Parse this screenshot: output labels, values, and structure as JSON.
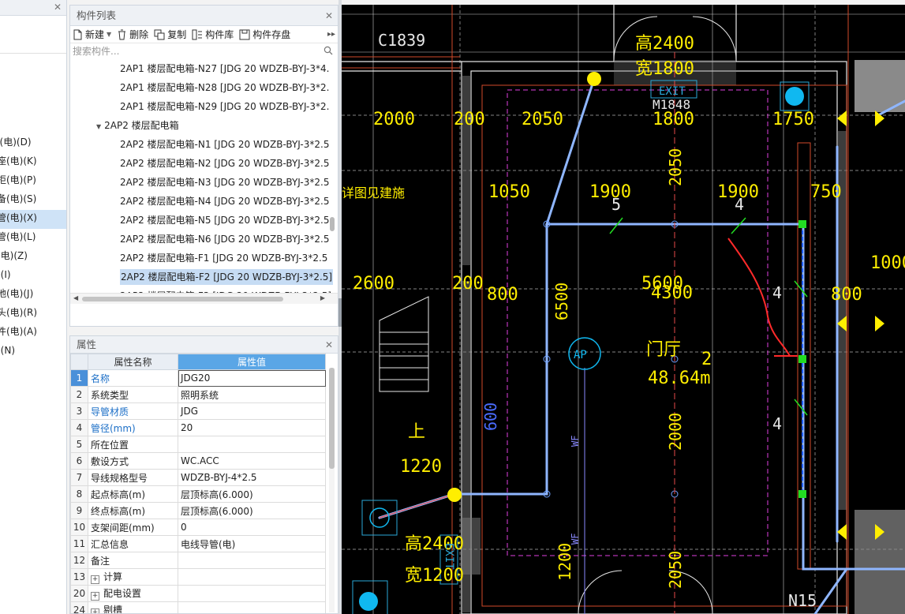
{
  "left_tree": {
    "items": [
      {
        "label": "J具(电)(D)"
      },
      {
        "label": "插座(电)(K)"
      },
      {
        "label": "箱柜(电)(P)"
      },
      {
        "label": "设备(电)(S)"
      },
      {
        "label": "导管(电)(X)",
        "selected": true
      },
      {
        "label": "等管(电)(L)"
      },
      {
        "label": "线(电)(Z)"
      },
      {
        "label": "电)(I)"
      },
      {
        "label": "接地(电)(J)"
      },
      {
        "label": "接头(电)(R)"
      },
      {
        "label": "构件(电)(A)"
      },
      {
        "label": "电)(N)"
      }
    ]
  },
  "component_panel": {
    "title": "构件列表",
    "toolbar": {
      "new": "新建",
      "delete": "删除",
      "copy": "复制",
      "library": "构件库",
      "save": "构件存盘"
    },
    "search_placeholder": "搜索构件...",
    "items": [
      {
        "label": "2AP1 楼层配电箱-N27 [JDG 20 WDZB-BYJ-3*4."
      },
      {
        "label": "2AP1 楼层配电箱-N28 [JDG 20 WDZB-BYJ-3*2."
      },
      {
        "label": "2AP1 楼层配电箱-N29 [JDG 20 WDZB-BYJ-3*2."
      },
      {
        "label": "2AP2 楼层配电箱",
        "group": true
      },
      {
        "label": "2AP2 楼层配电箱-N1 [JDG 20 WDZB-BYJ-3*2.5"
      },
      {
        "label": "2AP2 楼层配电箱-N2 [JDG 20 WDZB-BYJ-3*2.5"
      },
      {
        "label": "2AP2 楼层配电箱-N3 [JDG 20 WDZB-BYJ-3*2.5"
      },
      {
        "label": "2AP2 楼层配电箱-N4 [JDG 20 WDZB-BYJ-3*2.5"
      },
      {
        "label": "2AP2 楼层配电箱-N5 [JDG 20 WDZB-BYJ-3*2.5"
      },
      {
        "label": "2AP2 楼层配电箱-N6 [JDG 20 WDZB-BYJ-3*2.5"
      },
      {
        "label": "2AP2 楼层配电箱-F1 [JDG 20 WDZB-BYJ-3*2.5"
      },
      {
        "label": "2AP2 楼层配电箱-F2 [JDG 20 WDZB-BYJ-3*2.5]",
        "selected": true
      },
      {
        "label": "2AP2 楼层配电箱-F3 [JDG 20 WDZB-BYJ-3*2.5]"
      }
    ]
  },
  "properties_panel": {
    "title": "属性",
    "col_name": "属性名称",
    "col_value": "属性值",
    "rows": [
      {
        "idx": "1",
        "key": "名称",
        "value": "JDG20",
        "blue": true,
        "selected": true
      },
      {
        "idx": "2",
        "key": "系统类型",
        "value": "照明系统"
      },
      {
        "idx": "3",
        "key": "导管材质",
        "value": "JDG",
        "blue": true
      },
      {
        "idx": "4",
        "key": "管径(mm)",
        "value": "20",
        "blue": true
      },
      {
        "idx": "5",
        "key": "所在位置",
        "value": ""
      },
      {
        "idx": "6",
        "key": "敷设方式",
        "value": "WC.ACC"
      },
      {
        "idx": "7",
        "key": "导线规格型号",
        "value": "WDZB-BYJ-4*2.5"
      },
      {
        "idx": "8",
        "key": "起点标高(m)",
        "value": "层顶标高(6.000)"
      },
      {
        "idx": "9",
        "key": "终点标高(m)",
        "value": "层顶标高(6.000)"
      },
      {
        "idx": "10",
        "key": "支架间距(mm)",
        "value": "0"
      },
      {
        "idx": "11",
        "key": "汇总信息",
        "value": "电线导管(电)"
      },
      {
        "idx": "12",
        "key": "备注",
        "value": ""
      },
      {
        "idx": "13",
        "key": "计算",
        "value": "",
        "expand": true
      },
      {
        "idx": "20",
        "key": "配电设置",
        "value": "",
        "expand": true
      },
      {
        "idx": "24",
        "key": "剔槽",
        "value": "",
        "expand": true
      }
    ]
  },
  "cad_labels": {
    "room_c1839": "C1839",
    "h2400_top": "高2400",
    "w1800_top": "宽1800",
    "exit_top": "EXIT",
    "m1848": "M1848",
    "d2000": "2000",
    "d200a": "200",
    "d2050a": "2050",
    "d1800": "1800",
    "d1750": "1750",
    "detail_note": "详图见建施",
    "d1050": "1050",
    "d1900a": "1900",
    "d1900b": "1900",
    "d5": "5",
    "d4a": "4",
    "d750": "750",
    "d2050v": "2050",
    "d2600": "2600",
    "d200b": "200",
    "d800a": "800",
    "d5600": "5600",
    "d4300": "4300",
    "d1000": "1000",
    "d800b": "800",
    "d6500": "6500",
    "ap": "AP",
    "hall": "门厅",
    "area": "48.64m",
    "d2": "2",
    "d4b": "4",
    "d4c": "4",
    "d600": "600",
    "up": "上",
    "d1220": "1220",
    "d2000v": "2000",
    "wf1": "WF",
    "wf2": "WF",
    "h2400_bot": "高2400",
    "exit_bot": "EXIT",
    "w1200": "宽1200",
    "d1200v": "1200",
    "d2050v2": "2050",
    "n15": "N15"
  }
}
